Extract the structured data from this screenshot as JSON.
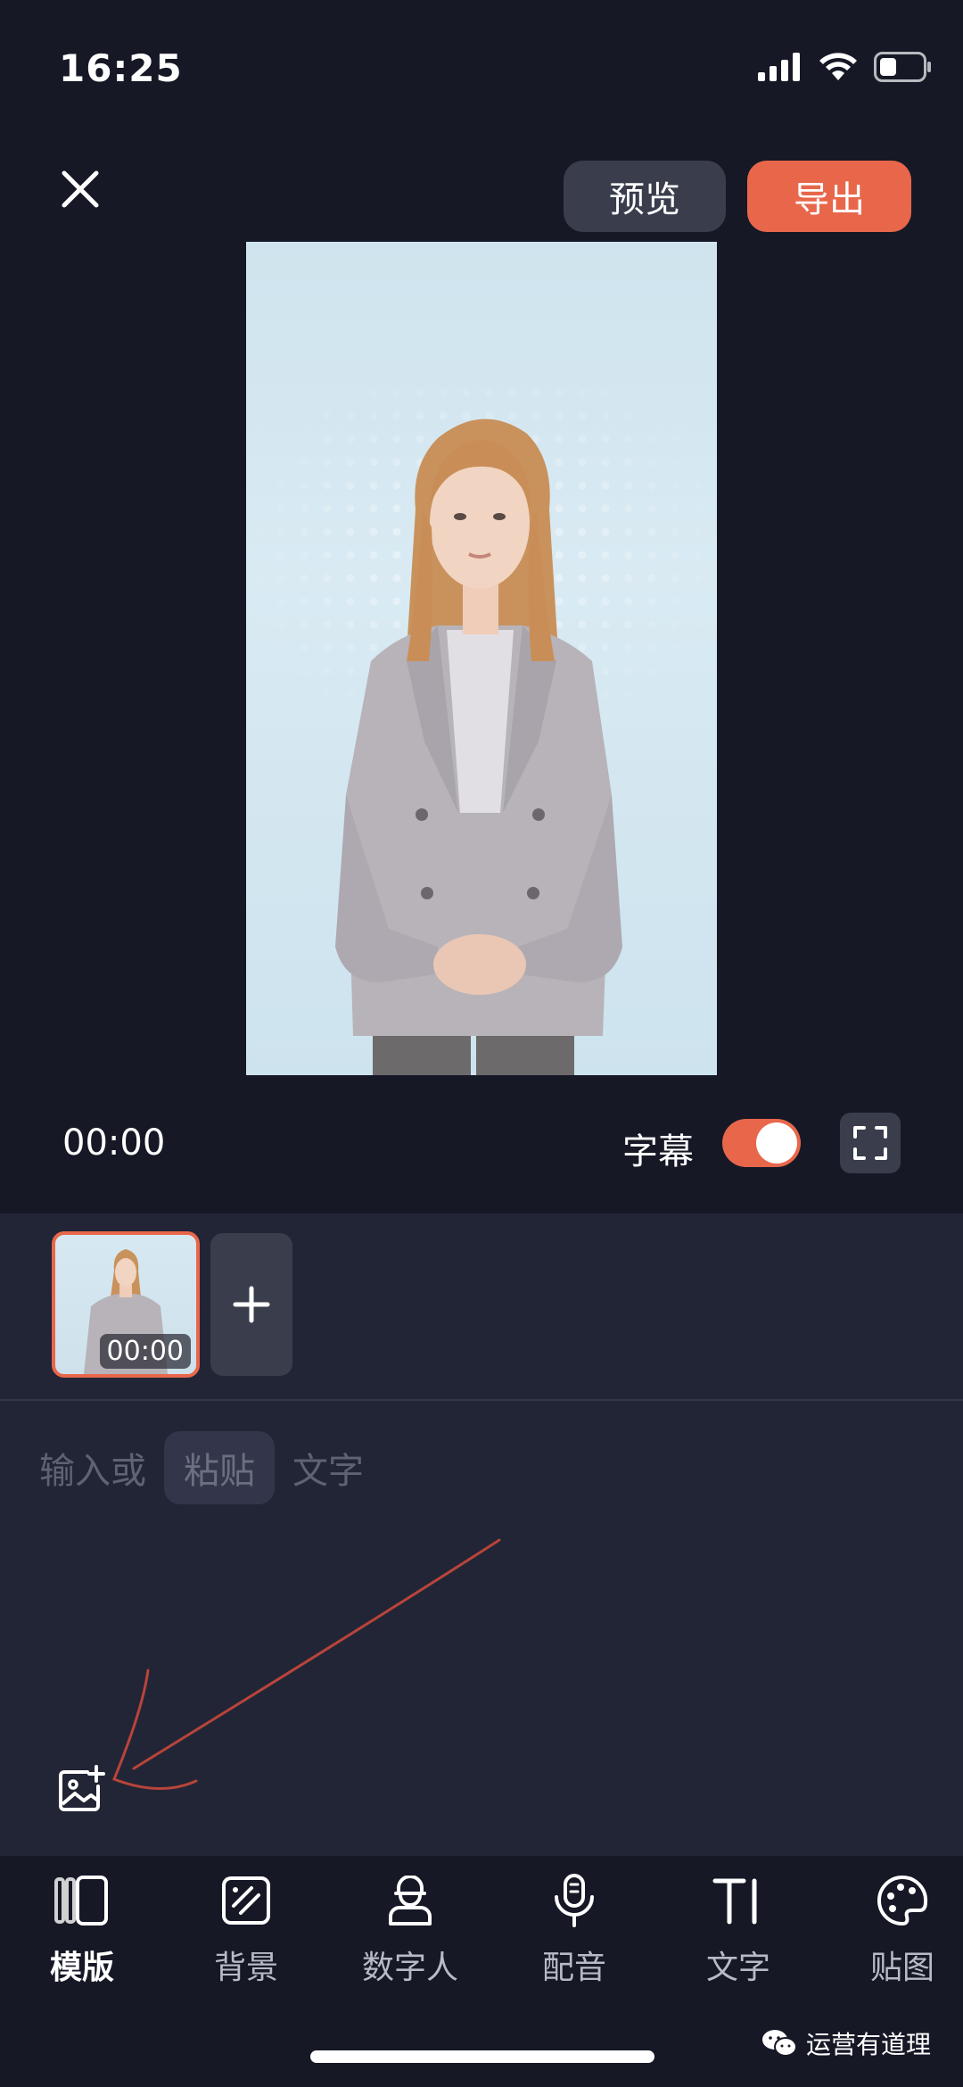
{
  "status_bar": {
    "time": "16:25",
    "icons": [
      "signal-icon",
      "wifi-icon",
      "battery-icon"
    ]
  },
  "header": {
    "close_icon": "close-icon",
    "preview_label": "预览",
    "export_label": "导出"
  },
  "player": {
    "timecode": "00:00",
    "subtitle_label": "字幕",
    "subtitle_enabled": true,
    "fullscreen_icon": "fullscreen-icon"
  },
  "clips": {
    "items": [
      {
        "duration": "00:00",
        "selected": true
      }
    ],
    "add_icon": "plus-icon"
  },
  "text_input": {
    "prefix": "输入或",
    "paste_label": "粘贴",
    "suffix": "文字",
    "image_add_icon": "add-image-icon"
  },
  "toolbar": {
    "items": [
      {
        "label": "模版",
        "icon": "template-icon",
        "active": true
      },
      {
        "label": "背景",
        "icon": "background-icon",
        "active": false
      },
      {
        "label": "数字人",
        "icon": "avatar-icon",
        "active": false
      },
      {
        "label": "配音",
        "icon": "microphone-icon",
        "active": false
      },
      {
        "label": "文字",
        "icon": "text-icon",
        "active": false
      },
      {
        "label": "贴图",
        "icon": "sticker-icon",
        "active": false
      }
    ]
  },
  "watermark": {
    "text": "运营有道理"
  },
  "colors": {
    "accent": "#e8674b",
    "background": "#161826",
    "panel": "#222535"
  }
}
